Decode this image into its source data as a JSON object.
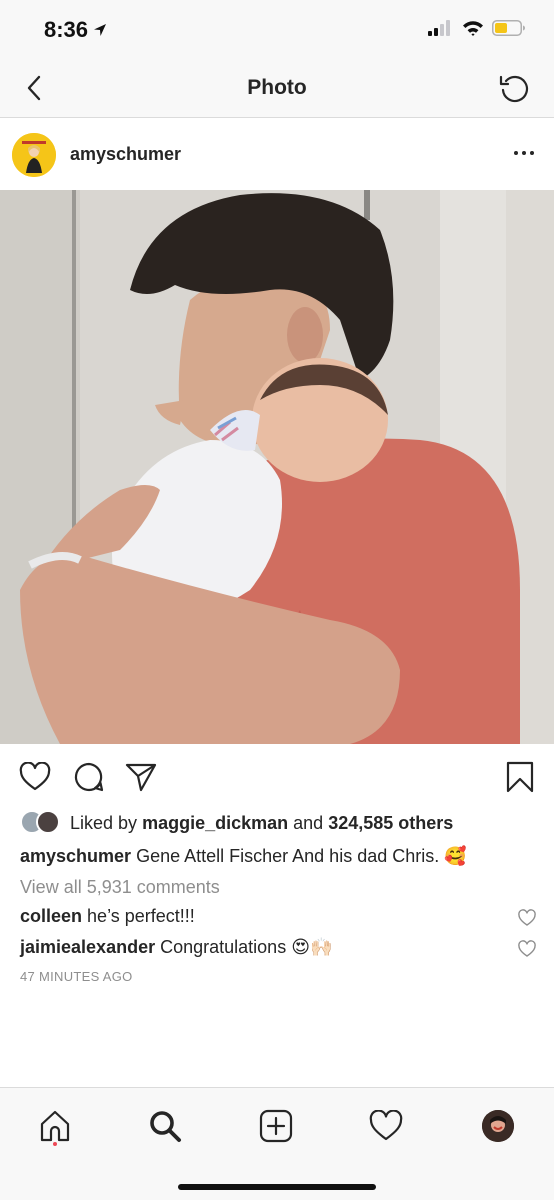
{
  "status_bar": {
    "time": "8:36",
    "location_icon": "location-arrow-icon",
    "signal_icon": "cellular-signal-icon",
    "wifi_icon": "wifi-icon",
    "battery_icon": "battery-icon",
    "battery_color": "#f5c518"
  },
  "nav": {
    "title": "Photo",
    "back_icon": "chevron-left-icon",
    "refresh_icon": "refresh-icon"
  },
  "post": {
    "username": "amyschumer",
    "avatar_icon": "profile-avatar",
    "more_icon": "more-horizontal-icon",
    "photo_icon": "post-photo"
  },
  "actions": {
    "like_icon": "heart-icon",
    "comment_icon": "comment-icon",
    "share_icon": "send-icon",
    "save_icon": "bookmark-icon"
  },
  "likes": {
    "prefix": "Liked by",
    "user": "maggie_dickman",
    "conjunction": "and",
    "others": "324,585 others"
  },
  "caption": {
    "username": "amyschumer",
    "text": "Gene Attell Fischer And his dad Chris.",
    "emoji": "🥰"
  },
  "view_all_comments": "View all 5,931 comments",
  "comments": [
    {
      "username": "colleen",
      "text": "he’s perfect!!!",
      "emoji": ""
    },
    {
      "username": "jaimiealexander",
      "text": "Congratulations",
      "emoji": "😍🙌🏻"
    }
  ],
  "timestamp": "47 MINUTES AGO",
  "tab_bar": {
    "home_icon": "home-icon",
    "search_icon": "search-icon",
    "add_icon": "add-post-icon",
    "activity_icon": "heart-icon",
    "profile_icon": "profile-avatar",
    "notification_dot_color": "#ed4956"
  }
}
